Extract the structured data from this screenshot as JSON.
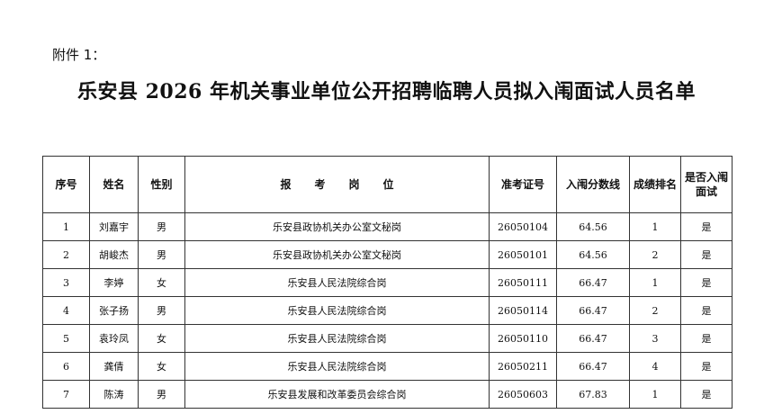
{
  "attachment_label": "附件 1：",
  "title": "乐安县 2026 年机关事业单位公开招聘临聘人员拟入闱面试人员名单",
  "table": {
    "headers": {
      "seq": "序号",
      "name": "姓名",
      "gender": "性别",
      "post": "报考岗位",
      "ticket": "准考证号",
      "cutoff": "入闱分数线",
      "rank": "成绩排名",
      "interview": "是否入闱面试"
    },
    "rows": [
      {
        "seq": "1",
        "name": "刘嘉宇",
        "gender": "男",
        "post": "乐安县政协机关办公室文秘岗",
        "ticket": "26050104",
        "cutoff": "64.56",
        "rank": "1",
        "interview": "是"
      },
      {
        "seq": "2",
        "name": "胡峻杰",
        "gender": "男",
        "post": "乐安县政协机关办公室文秘岗",
        "ticket": "26050101",
        "cutoff": "64.56",
        "rank": "2",
        "interview": "是"
      },
      {
        "seq": "3",
        "name": "李婷",
        "gender": "女",
        "post": "乐安县人民法院综合岗",
        "ticket": "26050111",
        "cutoff": "66.47",
        "rank": "1",
        "interview": "是"
      },
      {
        "seq": "4",
        "name": "张子扬",
        "gender": "男",
        "post": "乐安县人民法院综合岗",
        "ticket": "26050114",
        "cutoff": "66.47",
        "rank": "2",
        "interview": "是"
      },
      {
        "seq": "5",
        "name": "袁玲凤",
        "gender": "女",
        "post": "乐安县人民法院综合岗",
        "ticket": "26050110",
        "cutoff": "66.47",
        "rank": "3",
        "interview": "是"
      },
      {
        "seq": "6",
        "name": "龚倩",
        "gender": "女",
        "post": "乐安县人民法院综合岗",
        "ticket": "26050211",
        "cutoff": "66.47",
        "rank": "4",
        "interview": "是"
      },
      {
        "seq": "7",
        "name": "陈涛",
        "gender": "男",
        "post": "乐安县发展和改革委员会综合岗",
        "ticket": "26050603",
        "cutoff": "67.83",
        "rank": "1",
        "interview": "是"
      }
    ]
  }
}
